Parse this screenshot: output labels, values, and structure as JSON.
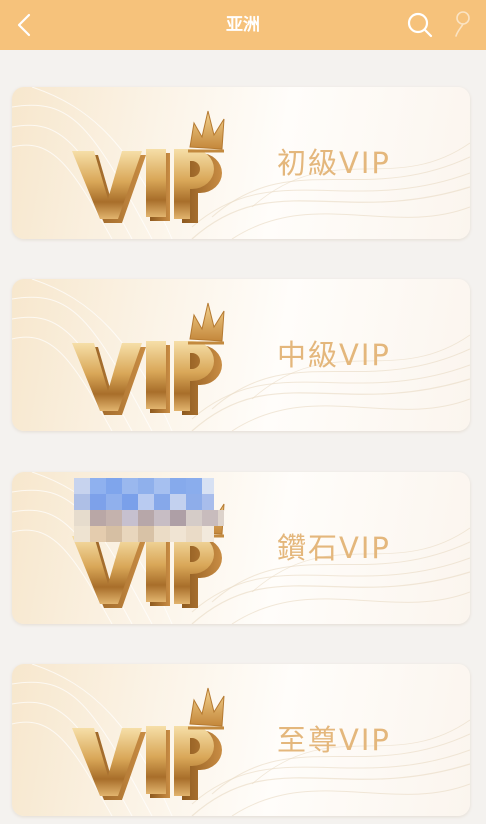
{
  "header": {
    "title": "亚洲",
    "back_icon": "chevron-left-icon",
    "search_icon": "search-icon",
    "user_icon": "user-icon"
  },
  "cards": [
    {
      "label": "初級VIP",
      "logo": "VIP"
    },
    {
      "label": "中級VIP",
      "logo": "VIP"
    },
    {
      "label": "鑽石VIP",
      "logo": "VIP"
    },
    {
      "label": "至尊VIP",
      "logo": "VIP"
    }
  ],
  "colors": {
    "header_bg": "#f6c27b",
    "label_gold": "#e4b77c",
    "page_bg": "#f4f2ef"
  }
}
